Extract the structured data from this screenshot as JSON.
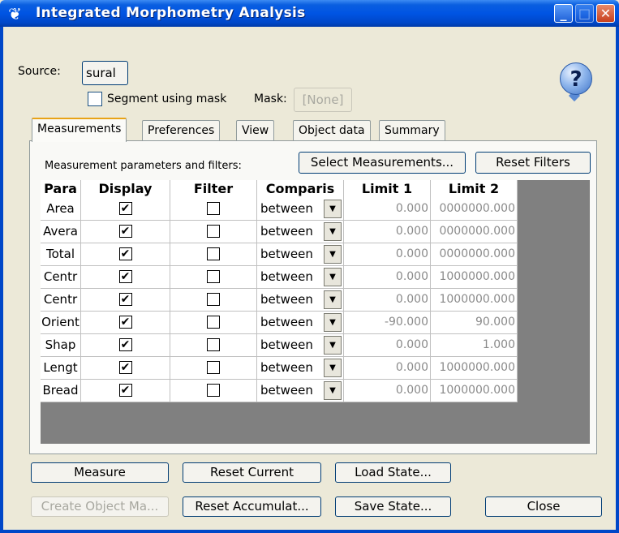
{
  "window": {
    "title": "Integrated Morphometry Analysis"
  },
  "source": {
    "label": "Source:",
    "value": "sural"
  },
  "segment": {
    "label": "Segment using mask",
    "mask_label": "Mask:",
    "mask_value": "[None]"
  },
  "tabs": [
    {
      "label": "Measurements",
      "active": true
    },
    {
      "label": "Preferences",
      "active": false
    },
    {
      "label": "View",
      "active": false
    },
    {
      "label": "Object data",
      "active": false
    },
    {
      "label": "Summary",
      "active": false
    }
  ],
  "measurements": {
    "caption": "Measurement parameters and filters:",
    "select_button": "Select Measurements...",
    "reset_filters_button": "Reset Filters",
    "columns": [
      "Para",
      "Display",
      "Filter",
      "Comparis",
      "Limit 1",
      "Limit 2"
    ],
    "rows": [
      {
        "param": "Area",
        "display": true,
        "filter": false,
        "comparison": "between",
        "limit1": "0.000",
        "limit2": "0000000.000"
      },
      {
        "param": "Avera",
        "display": true,
        "filter": false,
        "comparison": "between",
        "limit1": "0.000",
        "limit2": "0000000.000"
      },
      {
        "param": "Total",
        "display": true,
        "filter": false,
        "comparison": "between",
        "limit1": "0.000",
        "limit2": "0000000.000"
      },
      {
        "param": "Centr",
        "display": true,
        "filter": false,
        "comparison": "between",
        "limit1": "0.000",
        "limit2": "1000000.000"
      },
      {
        "param": "Centr",
        "display": true,
        "filter": false,
        "comparison": "between",
        "limit1": "0.000",
        "limit2": "1000000.000"
      },
      {
        "param": "Orient",
        "display": true,
        "filter": false,
        "comparison": "between",
        "limit1": "-90.000",
        "limit2": "90.000"
      },
      {
        "param": "Shap",
        "display": true,
        "filter": false,
        "comparison": "between",
        "limit1": "0.000",
        "limit2": "1.000"
      },
      {
        "param": "Lengt",
        "display": true,
        "filter": false,
        "comparison": "between",
        "limit1": "0.000",
        "limit2": "1000000.000"
      },
      {
        "param": "Bread",
        "display": true,
        "filter": false,
        "comparison": "between",
        "limit1": "0.000",
        "limit2": "1000000.000"
      }
    ]
  },
  "buttons": {
    "measure": "Measure",
    "reset_current": "Reset Current",
    "load_state": "Load State...",
    "create_object_mask": "Create Object Ma...",
    "reset_accumulated": "Reset Accumulat...",
    "save_state": "Save State...",
    "close": "Close"
  },
  "icons": {
    "app": "app-logo-icon",
    "help": "help-question-icon",
    "dropdown": "chevron-down-icon",
    "check": "checkmark-icon"
  },
  "colors": {
    "titlebar": "#0054e3",
    "dialog_bg": "#ece9d8",
    "active_tab_accent": "#e8a317",
    "grid_bg": "#808080"
  }
}
